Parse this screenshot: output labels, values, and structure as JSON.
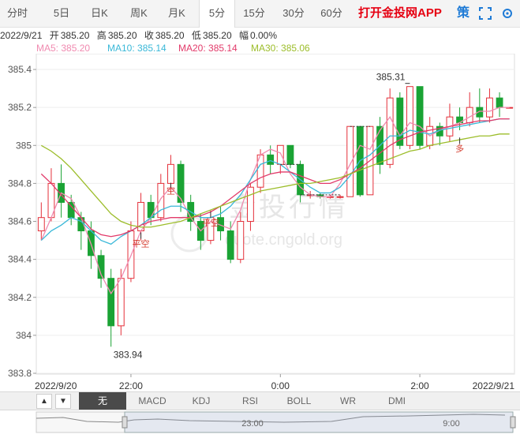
{
  "tabs": [
    {
      "label": "分时"
    },
    {
      "label": "5日"
    },
    {
      "label": "日K"
    },
    {
      "label": "周K"
    },
    {
      "label": "月K"
    },
    {
      "label": "5分",
      "active": true
    },
    {
      "label": "15分"
    },
    {
      "label": "30分"
    },
    {
      "label": "60分"
    }
  ],
  "app_link": "打开金投网APP",
  "tools": {
    "strategy": "策",
    "fullscreen_icon": "fullscreen-icon",
    "settings_icon": "settings-icon"
  },
  "info": {
    "date": "2022/9/21",
    "open_label": "开",
    "open": "385.20",
    "high_label": "高",
    "high": "385.20",
    "close_label": "收",
    "close": "385.20",
    "low_label": "低",
    "low": "385.20",
    "amp_label": "幅",
    "amp": "0.00%"
  },
  "ma": [
    {
      "label": "MA5: 385.20",
      "color": "#f08ab0"
    },
    {
      "label": "MA10: 385.14",
      "color": "#3ab8d8"
    },
    {
      "label": "MA20: 385.14",
      "color": "#e23a6a"
    },
    {
      "label": "MA30: 385.06",
      "color": "#9cbd2a"
    }
  ],
  "watermark": {
    "brand": "金投行情",
    "url": "quote.cngold.org"
  },
  "indicators": [
    "无",
    "MACD",
    "KDJ",
    "RSI",
    "BOLL",
    "WR",
    "DMI"
  ],
  "nav": {
    "labels": [
      "23:00",
      "9:00"
    ]
  },
  "chart_data": {
    "type": "candlestick",
    "ylim": [
      383.8,
      385.45
    ],
    "y_ticks": [
      "385.4",
      "385.2",
      "385",
      "384.8",
      "384.6",
      "384.4",
      "384.2",
      "384",
      "383.8"
    ],
    "y_tick_values": [
      385.4,
      385.2,
      385,
      384.8,
      384.6,
      384.4,
      384.2,
      384,
      383.8
    ],
    "x_tick_labels": [
      "2022/9/20",
      "22:00",
      "0:00",
      "2:00",
      "2022/9/21"
    ],
    "annotations": {
      "high": "385.31",
      "low": "383.94",
      "signals": [
        "空",
        "平空",
        "空",
        "平空",
        "多"
      ]
    },
    "colors": {
      "up": "#e4303a",
      "down": "#1aa334"
    },
    "candles": [
      {
        "o": 384.55,
        "c": 384.62,
        "h": 384.7,
        "l": 384.5
      },
      {
        "o": 384.62,
        "c": 384.8,
        "h": 384.88,
        "l": 384.6
      },
      {
        "o": 384.8,
        "c": 384.7,
        "h": 384.9,
        "l": 384.62
      },
      {
        "o": 384.7,
        "c": 384.62,
        "h": 384.74,
        "l": 384.58
      },
      {
        "o": 384.62,
        "c": 384.55,
        "h": 384.65,
        "l": 384.45
      },
      {
        "o": 384.55,
        "c": 384.42,
        "h": 384.6,
        "l": 384.35
      },
      {
        "o": 384.42,
        "c": 384.3,
        "h": 384.45,
        "l": 384.25
      },
      {
        "o": 384.3,
        "c": 384.05,
        "h": 384.35,
        "l": 383.94
      },
      {
        "o": 384.05,
        "c": 384.3,
        "h": 384.35,
        "l": 384.0
      },
      {
        "o": 384.3,
        "c": 384.55,
        "h": 384.6,
        "l": 384.28
      },
      {
        "o": 384.55,
        "c": 384.7,
        "h": 384.75,
        "l": 384.5
      },
      {
        "o": 384.7,
        "c": 384.62,
        "h": 384.74,
        "l": 384.58
      },
      {
        "o": 384.62,
        "c": 384.8,
        "h": 384.85,
        "l": 384.6
      },
      {
        "o": 384.8,
        "c": 384.9,
        "h": 384.95,
        "l": 384.75
      },
      {
        "o": 384.9,
        "c": 384.7,
        "h": 384.92,
        "l": 384.65
      },
      {
        "o": 384.7,
        "c": 384.6,
        "h": 384.74,
        "l": 384.55
      },
      {
        "o": 384.6,
        "c": 384.5,
        "h": 384.64,
        "l": 384.45
      },
      {
        "o": 384.5,
        "c": 384.62,
        "h": 384.66,
        "l": 384.48
      },
      {
        "o": 384.62,
        "c": 384.55,
        "h": 384.68,
        "l": 384.5
      },
      {
        "o": 384.55,
        "c": 384.4,
        "h": 384.6,
        "l": 384.38
      },
      {
        "o": 384.4,
        "c": 384.6,
        "h": 384.65,
        "l": 384.38
      },
      {
        "o": 384.6,
        "c": 384.78,
        "h": 384.8,
        "l": 384.55
      },
      {
        "o": 384.78,
        "c": 384.95,
        "h": 384.98,
        "l": 384.75
      },
      {
        "o": 384.95,
        "c": 384.9,
        "h": 385.0,
        "l": 384.85
      },
      {
        "o": 384.9,
        "c": 385.0,
        "h": 385.0,
        "l": 384.85
      },
      {
        "o": 385.0,
        "c": 384.9,
        "h": 385.0,
        "l": 384.88
      },
      {
        "o": 384.9,
        "c": 384.74,
        "h": 384.92,
        "l": 384.7
      },
      {
        "o": 384.74,
        "c": 384.74,
        "h": 384.76,
        "l": 384.72
      },
      {
        "o": 384.74,
        "c": 384.73,
        "h": 384.75,
        "l": 384.72
      },
      {
        "o": 384.73,
        "c": 384.73,
        "h": 384.74,
        "l": 384.72
      },
      {
        "o": 384.73,
        "c": 384.73,
        "h": 384.74,
        "l": 384.72
      },
      {
        "o": 384.73,
        "c": 385.1,
        "h": 385.1,
        "l": 384.73
      },
      {
        "o": 385.1,
        "c": 384.74,
        "h": 385.1,
        "l": 384.73
      },
      {
        "o": 384.74,
        "c": 385.1,
        "h": 385.1,
        "l": 384.74
      },
      {
        "o": 385.1,
        "c": 384.9,
        "h": 385.15,
        "l": 384.85
      },
      {
        "o": 384.9,
        "c": 385.25,
        "h": 385.3,
        "l": 384.88
      },
      {
        "o": 385.25,
        "c": 385.0,
        "h": 385.28,
        "l": 384.98
      },
      {
        "o": 385.0,
        "c": 385.31,
        "h": 385.31,
        "l": 384.98
      },
      {
        "o": 385.31,
        "c": 385.0,
        "h": 385.31,
        "l": 384.98
      },
      {
        "o": 385.0,
        "c": 385.1,
        "h": 385.15,
        "l": 384.98
      },
      {
        "o": 385.1,
        "c": 385.05,
        "h": 385.12,
        "l": 385.0
      },
      {
        "o": 385.05,
        "c": 385.15,
        "h": 385.22,
        "l": 385.02
      },
      {
        "o": 385.15,
        "c": 385.12,
        "h": 385.2,
        "l": 385.08
      },
      {
        "o": 385.12,
        "c": 385.2,
        "h": 385.28,
        "l": 385.1
      },
      {
        "o": 385.2,
        "c": 385.15,
        "h": 385.3,
        "l": 385.12
      },
      {
        "o": 385.15,
        "c": 385.25,
        "h": 385.3,
        "l": 385.12
      },
      {
        "o": 385.25,
        "c": 385.2,
        "h": 385.28,
        "l": 385.15
      },
      {
        "o": 385.2,
        "c": 385.2,
        "h": 385.2,
        "l": 385.2
      }
    ],
    "series": [
      {
        "name": "MA5",
        "color": "#f08ab0",
        "values": [
          384.5,
          384.62,
          384.75,
          384.72,
          384.62,
          384.48,
          384.32,
          384.22,
          384.3,
          384.42,
          384.55,
          384.62,
          384.72,
          384.78,
          384.72,
          384.62,
          384.55,
          384.6,
          384.58,
          384.56,
          384.66,
          384.82,
          384.95,
          384.98,
          384.96,
          384.85,
          384.78,
          384.74,
          384.73,
          384.73,
          384.8,
          384.9,
          385.0,
          384.98,
          385.08,
          385.15,
          385.05,
          385.12,
          385.1,
          385.05,
          385.08,
          385.1,
          385.12,
          385.15,
          385.18,
          385.18,
          385.2,
          385.2
        ]
      },
      {
        "name": "MA10",
        "color": "#3ab8d8",
        "values": [
          384.5,
          384.55,
          384.58,
          384.62,
          384.6,
          384.55,
          384.5,
          384.48,
          384.52,
          384.55,
          384.58,
          384.62,
          384.66,
          384.68,
          384.68,
          384.65,
          384.62,
          384.62,
          384.64,
          384.68,
          384.74,
          384.82,
          384.9,
          384.92,
          384.9,
          384.86,
          384.82,
          384.78,
          384.75,
          384.75,
          384.78,
          384.84,
          384.92,
          384.95,
          385.0,
          385.05,
          385.05,
          385.08,
          385.07,
          385.06,
          385.08,
          385.09,
          385.1,
          385.11,
          385.12,
          385.13,
          385.14,
          385.14
        ]
      },
      {
        "name": "MA20",
        "color": "#e23a6a",
        "values": [
          384.85,
          384.8,
          384.74,
          384.68,
          384.62,
          384.56,
          384.53,
          384.52,
          384.53,
          384.55,
          384.58,
          384.6,
          384.61,
          384.62,
          384.62,
          384.62,
          384.63,
          384.65,
          384.68,
          384.72,
          384.76,
          384.8,
          384.83,
          384.85,
          384.86,
          384.86,
          384.84,
          384.82,
          384.8,
          384.8,
          384.82,
          384.85,
          384.88,
          384.92,
          384.96,
          385.0,
          385.03,
          385.05,
          385.07,
          385.08,
          385.09,
          385.1,
          385.11,
          385.12,
          385.13,
          385.13,
          385.14,
          385.14
        ]
      },
      {
        "name": "MA30",
        "color": "#9cbd2a",
        "values": [
          385.0,
          384.97,
          384.93,
          384.88,
          384.82,
          384.76,
          384.7,
          384.64,
          384.6,
          384.58,
          384.57,
          384.57,
          384.58,
          384.59,
          384.6,
          384.62,
          384.64,
          384.66,
          384.68,
          384.7,
          384.72,
          384.74,
          384.76,
          384.77,
          384.78,
          384.79,
          384.8,
          384.8,
          384.81,
          384.82,
          384.83,
          384.85,
          384.87,
          384.89,
          384.91,
          384.93,
          384.95,
          384.97,
          384.98,
          385.0,
          385.01,
          385.02,
          385.03,
          385.04,
          385.05,
          385.05,
          385.06,
          385.06
        ]
      }
    ]
  }
}
